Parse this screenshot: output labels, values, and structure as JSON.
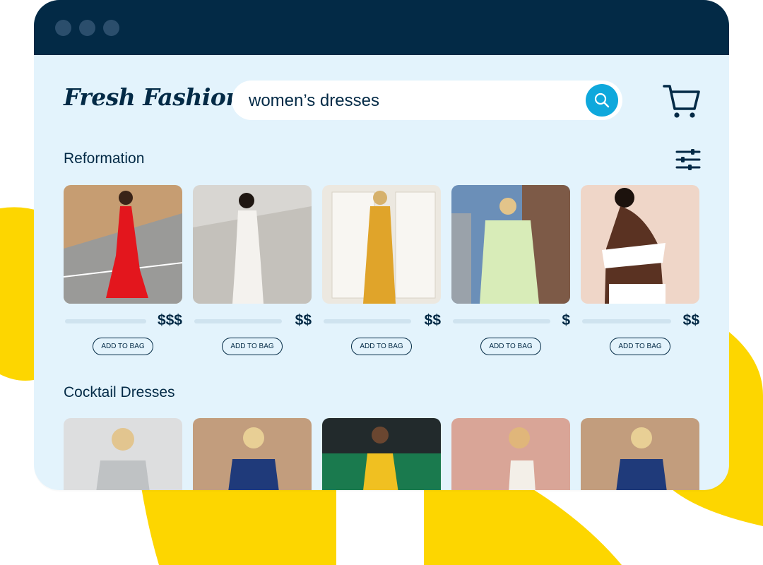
{
  "brand": {
    "logo_text": "Fresh Fashion"
  },
  "search": {
    "value": "women’s dresses",
    "icon": "search-icon"
  },
  "header": {
    "cart_icon": "cart-icon",
    "filter_icon": "sliders-icon"
  },
  "sections": [
    {
      "title": "Reformation",
      "products": [
        {
          "price": "$$$",
          "button_label": "ADD TO BAG",
          "dress_color": "#e3161d"
        },
        {
          "price": "$$",
          "button_label": "ADD TO BAG",
          "dress_color": "#f4f2ee"
        },
        {
          "price": "$$",
          "button_label": "ADD TO BAG",
          "dress_color": "#e0a42a"
        },
        {
          "price": "$",
          "button_label": "ADD TO BAG",
          "dress_color": "#d8ecb8"
        },
        {
          "price": "$$",
          "button_label": "ADD TO BAG",
          "dress_color": "#ffffff"
        }
      ]
    },
    {
      "title": "Cocktail Dresses",
      "products": [
        {
          "dress_color": "#bfc2c4"
        },
        {
          "dress_color": "#1f3a7a"
        },
        {
          "dress_color": "#f0c021"
        },
        {
          "dress_color": "#f3efe8"
        },
        {
          "dress_color": "#1f3a7a"
        }
      ]
    }
  ],
  "colors": {
    "titlebar": "#032a46",
    "background": "#e3f3fc",
    "accent": "#0fa8dc",
    "deco_yellow": "#fdd600"
  }
}
